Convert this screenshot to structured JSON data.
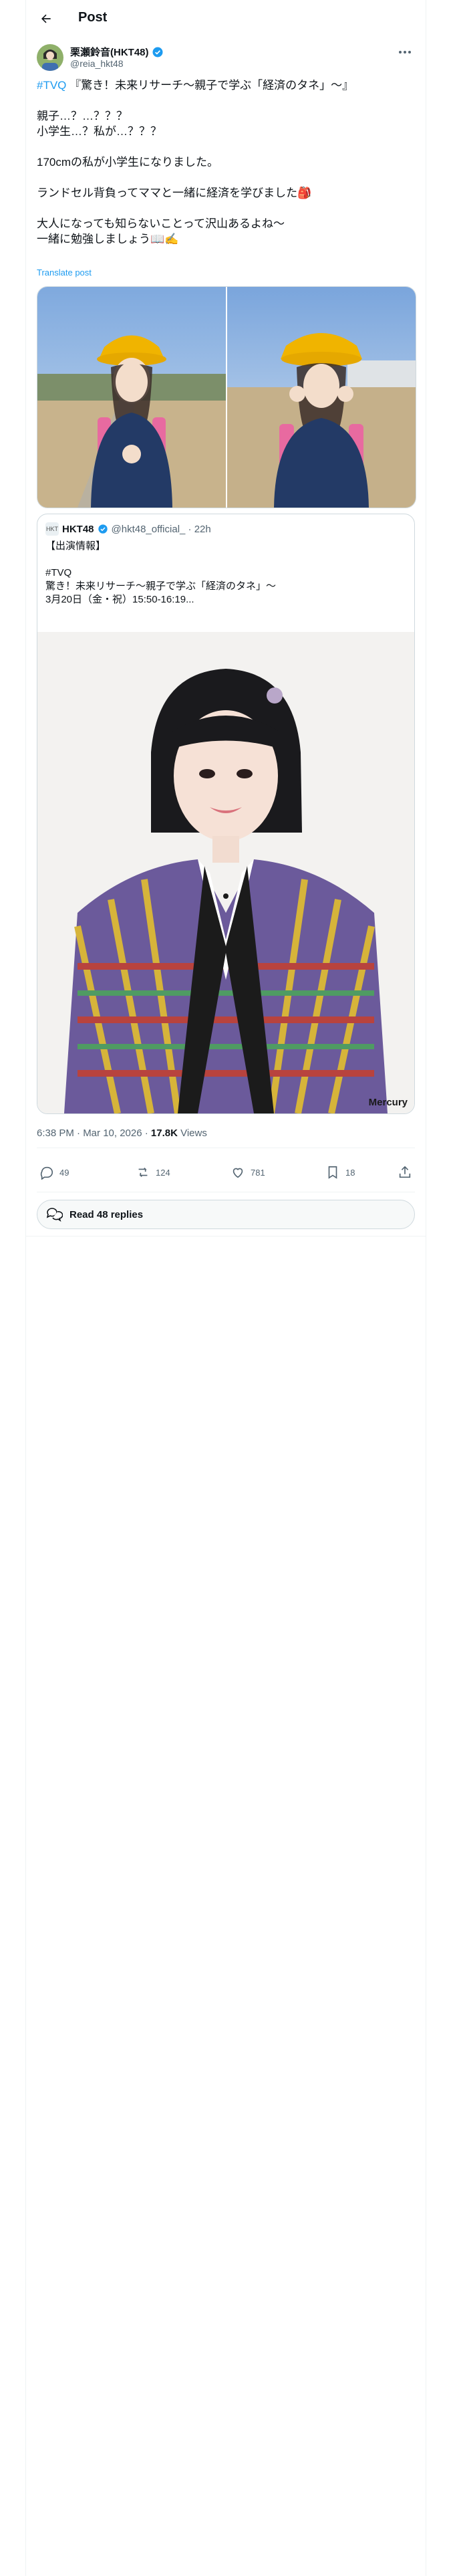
{
  "header": {
    "title": "Post"
  },
  "author": {
    "name": "栗瀬鈴音(HKT48)",
    "handle": "@reia_hkt48"
  },
  "post": {
    "hashtag": "#TVQ",
    "line1_rest": " 『驚き！未来リサーチ〜親子で学ぶ「経済のタネ」〜』",
    "line3": "親子…？…？？？",
    "line4": "小学生…？私が…？？？",
    "line6": "170cmの私が小学生になりました。",
    "line8": "ランドセル背負ってママと一緒に経済を学びました🎒",
    "line10": "大人になっても知らないことって沢山あるよね〜",
    "line11": "一緒に勉強しましょう📖✍️",
    "translate": "Translate post"
  },
  "quote": {
    "avatar_text": "HKT",
    "name": "HKT48",
    "handle_time": "@hkt48_official_ · 22h",
    "lines": [
      "【出演情報】",
      "",
      "#TVQ",
      "驚き！未来リサーチ〜親子で学ぶ「経済のタネ」〜",
      "3月20日（金・祝）15:50-16:19..."
    ],
    "watermark": "Mercury"
  },
  "meta": {
    "datetime": "6:38 PM · Mar 10, 2026 · ",
    "views_count": "17.8K",
    "views_label": " Views"
  },
  "actions": {
    "replies": "49",
    "reposts": "124",
    "likes": "781",
    "bookmarks": "18"
  },
  "read_replies": "Read 48 replies",
  "colors": {
    "accent": "#1d9bf0",
    "verified": "#1d9bf0",
    "text": "#0f1419",
    "muted": "#536471"
  }
}
